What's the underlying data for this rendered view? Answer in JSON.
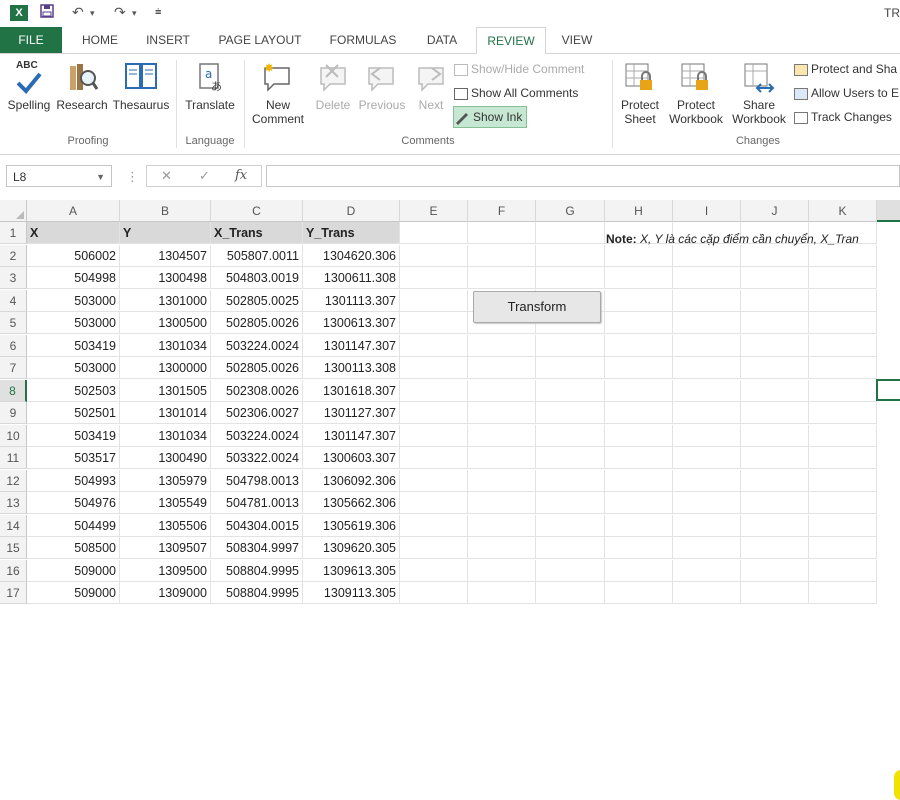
{
  "titlebar": {
    "app_icon_label": "X",
    "title": "TR"
  },
  "tabs": [
    {
      "label": "FILE"
    },
    {
      "label": "HOME"
    },
    {
      "label": "INSERT"
    },
    {
      "label": "PAGE LAYOUT"
    },
    {
      "label": "FORMULAS"
    },
    {
      "label": "DATA"
    },
    {
      "label": "REVIEW"
    },
    {
      "label": "VIEW"
    }
  ],
  "ribbon": {
    "proofing": {
      "label": "Proofing",
      "spelling": "Spelling",
      "spelling_abc": "ABC",
      "research": "Research",
      "thesaurus": "Thesaurus"
    },
    "language": {
      "label": "Language",
      "translate": "Translate"
    },
    "comments": {
      "label": "Comments",
      "new_comment_line1": "New",
      "new_comment_line2": "Comment",
      "delete": "Delete",
      "previous": "Previous",
      "next": "Next",
      "show_hide_comment": "Show/Hide Comment",
      "show_all_comments": "Show All Comments",
      "show_ink": "Show Ink"
    },
    "changes": {
      "label": "Changes",
      "protect_sheet_line1": "Protect",
      "protect_sheet_line2": "Sheet",
      "protect_workbook_line1": "Protect",
      "protect_workbook_line2": "Workbook",
      "share_workbook_line1": "Share",
      "share_workbook_line2": "Workbook",
      "protect_and_share": "Protect and Sha",
      "allow_users": "Allow Users to E",
      "track_changes": "Track Changes"
    }
  },
  "formula_bar": {
    "name_box": "L8",
    "cancel_glyph": "✕",
    "enter_glyph": "✓",
    "fx_label": "fx",
    "formula": ""
  },
  "grid": {
    "columns": [
      "A",
      "B",
      "C",
      "D",
      "E",
      "F",
      "G",
      "H",
      "I",
      "J",
      "K"
    ],
    "selected_column": "L",
    "rows": [
      "1",
      "2",
      "3",
      "4",
      "5",
      "6",
      "7",
      "8",
      "9",
      "10",
      "11",
      "12",
      "13",
      "14",
      "15",
      "16",
      "17"
    ],
    "selected_row": "8",
    "headers": [
      "X",
      "Y",
      "X_Trans",
      "Y_Trans"
    ],
    "data": [
      [
        "506002",
        "1304507",
        "505807.0011",
        "1304620.306"
      ],
      [
        "504998",
        "1300498",
        "504803.0019",
        "1300611.308"
      ],
      [
        "503000",
        "1301000",
        "502805.0025",
        "1301113.307"
      ],
      [
        "503000",
        "1300500",
        "502805.0026",
        "1300613.307"
      ],
      [
        "503419",
        "1301034",
        "503224.0024",
        "1301147.307"
      ],
      [
        "503000",
        "1300000",
        "502805.0026",
        "1300113.308"
      ],
      [
        "502503",
        "1301505",
        "502308.0026",
        "1301618.307"
      ],
      [
        "502501",
        "1301014",
        "502306.0027",
        "1301127.307"
      ],
      [
        "503419",
        "1301034",
        "503224.0024",
        "1301147.307"
      ],
      [
        "503517",
        "1300490",
        "503322.0024",
        "1300603.307"
      ],
      [
        "504993",
        "1305979",
        "504798.0013",
        "1306092.306"
      ],
      [
        "504976",
        "1305549",
        "504781.0013",
        "1305662.306"
      ],
      [
        "504499",
        "1305506",
        "504304.0015",
        "1305619.306"
      ],
      [
        "508500",
        "1309507",
        "508304.9997",
        "1309620.305"
      ],
      [
        "509000",
        "1309500",
        "508804.9995",
        "1309613.305"
      ],
      [
        "509000",
        "1309000",
        "508804.9995",
        "1309113.305"
      ]
    ],
    "note_bold": "Note:",
    "note_text": " X, Y là các cặp điểm cần chuyển, X_Tran",
    "transform_button": "Transform"
  },
  "colors": {
    "excel_green": "#217346",
    "header_fill": "#d9d9d9",
    "show_ink_active": "#c6e7d1"
  }
}
